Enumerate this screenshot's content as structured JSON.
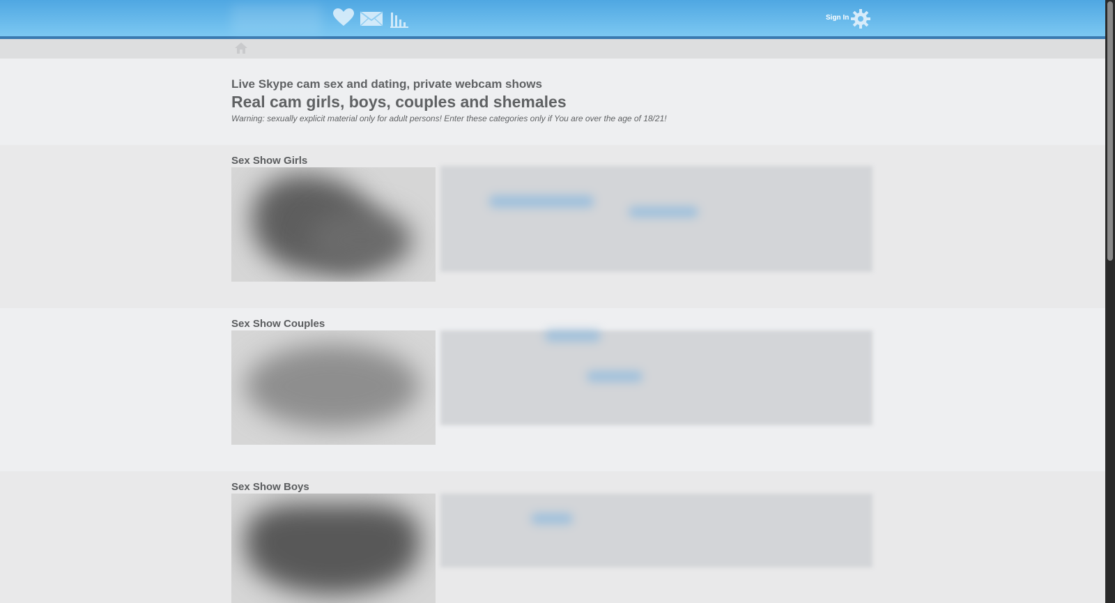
{
  "header": {
    "signin_label": "Sign In",
    "icons": [
      "heart-icon",
      "mail-icon",
      "stats-icon",
      "gear-icon"
    ],
    "bar_color": "#5bb4ea"
  },
  "subnav": {
    "icon": "home-icon"
  },
  "intro": {
    "title": "Live Skype cam sex and dating, private webcam shows",
    "subtitle": "Real cam girls, boys, couples and shemales",
    "warning": "Warning: sexually explicit material only for adult persons! Enter these categories only if You are over the age of 18/21!"
  },
  "sections": [
    {
      "title": "Sex Show Girls"
    },
    {
      "title": "Sex Show Couples"
    },
    {
      "title": "Sex Show Boys"
    }
  ]
}
